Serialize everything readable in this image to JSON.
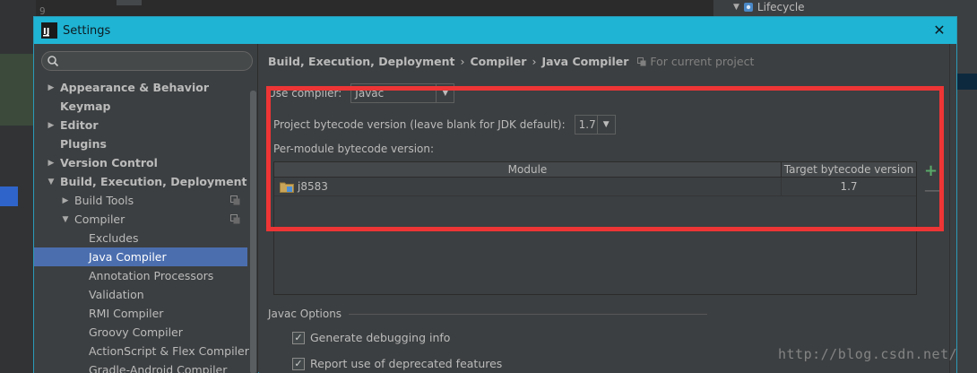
{
  "background": {
    "line_number": "9",
    "right_panel_item": "Lifecycle"
  },
  "dialog": {
    "title": "Settings",
    "close_symbol": "✕"
  },
  "sidebar": {
    "search_placeholder": "",
    "items": [
      {
        "label": "Appearance & Behavior",
        "arrow": "▶",
        "bold": true,
        "indent": 0
      },
      {
        "label": "Keymap",
        "arrow": "",
        "bold": true,
        "indent": 0
      },
      {
        "label": "Editor",
        "arrow": "▶",
        "bold": true,
        "indent": 0
      },
      {
        "label": "Plugins",
        "arrow": "",
        "bold": true,
        "indent": 0
      },
      {
        "label": "Version Control",
        "arrow": "▶",
        "bold": true,
        "indent": 0
      },
      {
        "label": "Build, Execution, Deployment",
        "arrow": "▼",
        "bold": true,
        "indent": 0
      },
      {
        "label": "Build Tools",
        "arrow": "▶",
        "bold": false,
        "indent": 1,
        "project_icon": true
      },
      {
        "label": "Compiler",
        "arrow": "▼",
        "bold": false,
        "indent": 1,
        "project_icon": true
      },
      {
        "label": "Excludes",
        "arrow": "",
        "bold": false,
        "indent": 2
      },
      {
        "label": "Java Compiler",
        "arrow": "",
        "bold": false,
        "indent": 2,
        "selected": true
      },
      {
        "label": "Annotation Processors",
        "arrow": "",
        "bold": false,
        "indent": 2
      },
      {
        "label": "Validation",
        "arrow": "",
        "bold": false,
        "indent": 2
      },
      {
        "label": "RMI Compiler",
        "arrow": "",
        "bold": false,
        "indent": 2
      },
      {
        "label": "Groovy Compiler",
        "arrow": "",
        "bold": false,
        "indent": 2
      },
      {
        "label": "ActionScript & Flex Compiler",
        "arrow": "",
        "bold": false,
        "indent": 2
      },
      {
        "label": "Gradle-Android Compiler",
        "arrow": "",
        "bold": false,
        "indent": 2
      }
    ]
  },
  "breadcrumb": {
    "parts": [
      "Build, Execution, Deployment",
      "Compiler",
      "Java Compiler"
    ],
    "separator": "›",
    "scope": "For current project"
  },
  "form": {
    "use_compiler_label": "Use compiler:",
    "use_compiler_value": "Javac",
    "project_bytecode_label": "Project bytecode version (leave blank for JDK default):",
    "project_bytecode_value": "1.7",
    "per_module_label": "Per-module bytecode version:"
  },
  "module_table": {
    "columns": [
      "Module",
      "Target bytecode version"
    ],
    "rows": [
      {
        "module": "j8583",
        "target": "1.7"
      }
    ],
    "add_symbol": "+",
    "remove_symbol": "—"
  },
  "javac_options": {
    "title": "Javac Options",
    "checkboxes": [
      {
        "label": "Generate debugging info",
        "checked": true
      },
      {
        "label": "Report use of deprecated features",
        "checked": true
      }
    ],
    "check_mark": "✓"
  },
  "watermark": "http://blog.csdn.net/",
  "colors": {
    "titlebar": "#1fb4d4",
    "selection": "#4b6eaf",
    "annotation_red": "#ee3535",
    "add_green": "#59a869"
  }
}
